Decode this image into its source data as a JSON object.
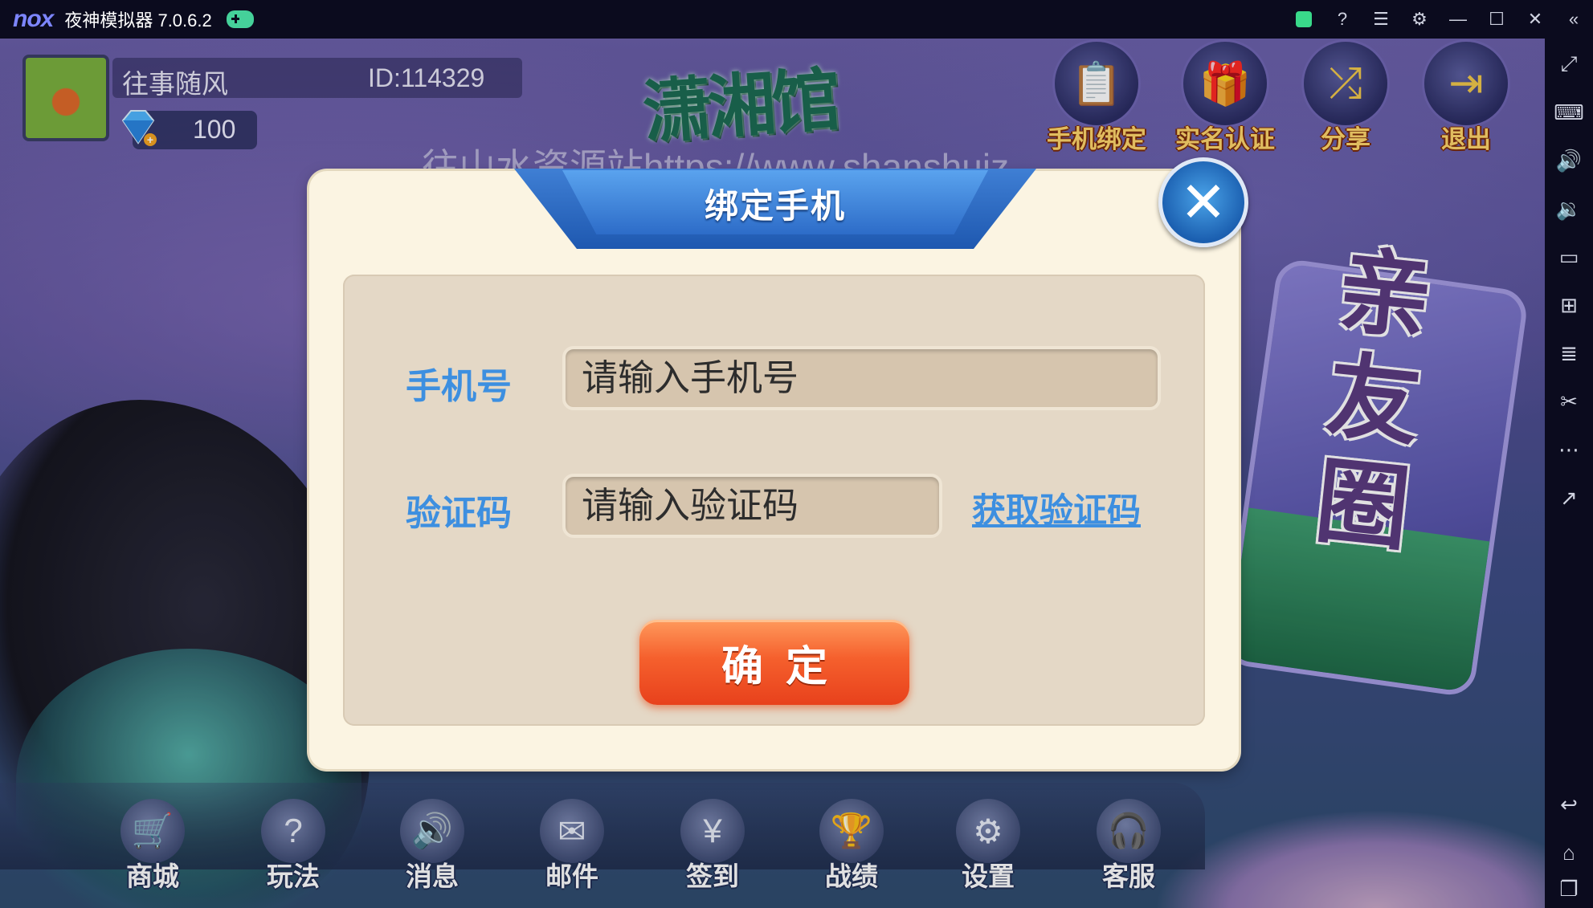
{
  "window": {
    "logo": "nox",
    "title": "夜神模拟器 7.0.6.2"
  },
  "player": {
    "name": "往事随风",
    "id": "ID:114329",
    "diamonds": "100"
  },
  "game_logo": "潇湘馆",
  "watermark": "往山水资源站https://www.shanshuiz",
  "top_buttons": [
    {
      "label": "手机绑定",
      "icon": "phone-bind-icon"
    },
    {
      "label": "实名认证",
      "icon": "gift-icon"
    },
    {
      "label": "分享",
      "icon": "share-icon"
    },
    {
      "label": "退出",
      "icon": "exit-icon"
    }
  ],
  "friends_circle": "亲友圈",
  "bottom_buttons": [
    {
      "label": "商城",
      "icon": "cart-icon"
    },
    {
      "label": "玩法",
      "icon": "help-icon"
    },
    {
      "label": "消息",
      "icon": "speaker-icon"
    },
    {
      "label": "邮件",
      "icon": "mail-icon"
    },
    {
      "label": "签到",
      "icon": "coin-hand-icon"
    },
    {
      "label": "战绩",
      "icon": "trophy-icon"
    },
    {
      "label": "设置",
      "icon": "gear-icon"
    },
    {
      "label": "客服",
      "icon": "headset-icon"
    }
  ],
  "dialog": {
    "title": "绑定手机",
    "phone_label": "手机号",
    "phone_placeholder": "请输入手机号",
    "code_label": "验证码",
    "code_placeholder": "请输入验证码",
    "get_code": "获取验证码",
    "confirm": "确定"
  },
  "colors": {
    "accent_blue": "#3d8fe0",
    "confirm_orange": "#f5602d",
    "dialog_bg": "#fbf4e2"
  }
}
